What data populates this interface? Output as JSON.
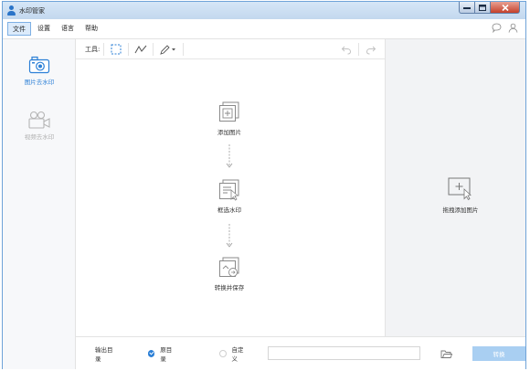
{
  "window": {
    "title": "水印管家"
  },
  "menubar": {
    "items": [
      {
        "label": "文件",
        "active": true
      },
      {
        "label": "设置",
        "active": false
      },
      {
        "label": "语言",
        "active": false
      },
      {
        "label": "帮助",
        "active": false
      }
    ]
  },
  "sidebar": {
    "items": [
      {
        "label": "图片去水印",
        "icon": "camera-icon",
        "active": true
      },
      {
        "label": "视频去水印",
        "icon": "video-camera-icon",
        "active": false
      }
    ]
  },
  "toolbar": {
    "label": "工具:"
  },
  "canvas": {
    "steps": [
      {
        "label": "添加图片",
        "icon": "add-image-icon"
      },
      {
        "label": "框选水印",
        "icon": "select-watermark-icon"
      },
      {
        "label": "转换并保存",
        "icon": "convert-save-icon"
      }
    ]
  },
  "rightpanel": {
    "drop_label": "拖拽添加图片"
  },
  "bottombar": {
    "output_label": "输出目录",
    "option_source": "原目录",
    "option_custom": "自定义",
    "path_value": "",
    "convert_label": "转换"
  },
  "colors": {
    "accent": "#2b7fd6",
    "convert_button": "#a9cff2",
    "titlebar": "#c3d8ee"
  }
}
